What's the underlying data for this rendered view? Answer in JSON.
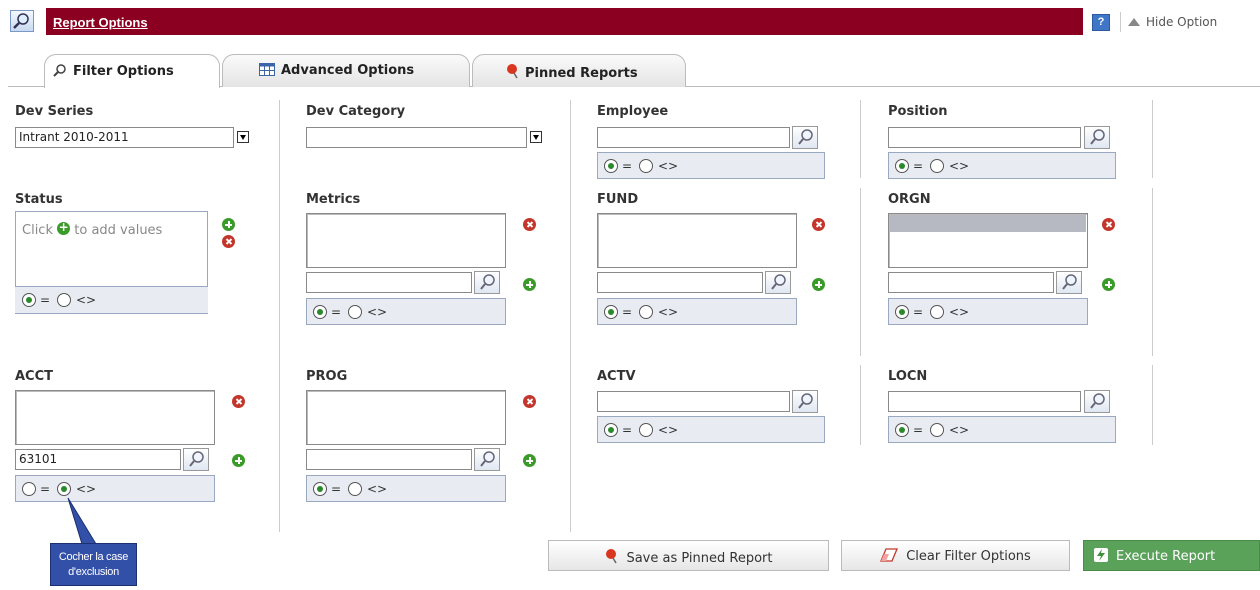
{
  "header": {
    "title": "Report Options",
    "help_label": "?",
    "hide_label": "Hide Option"
  },
  "tabs": [
    {
      "label": "Filter Options",
      "icon": "magnifier-icon",
      "active": true
    },
    {
      "label": "Advanced Options",
      "icon": "table-icon",
      "active": false
    },
    {
      "label": "Pinned Reports",
      "icon": "pin-icon",
      "active": false
    }
  ],
  "fields": {
    "dev_series": {
      "label": "Dev Series",
      "value": "Intrant 2010-2011"
    },
    "dev_category": {
      "label": "Dev Category",
      "value": ""
    },
    "employee": {
      "label": "Employee",
      "value": ""
    },
    "position": {
      "label": "Position",
      "value": ""
    },
    "status": {
      "label": "Status",
      "hint_pre": "Click",
      "hint_post": "to add values"
    },
    "metrics": {
      "label": "Metrics",
      "value": ""
    },
    "fund": {
      "label": "FUND",
      "value": ""
    },
    "orgn": {
      "label": "ORGN",
      "value": ""
    },
    "acct": {
      "label": "ACCT",
      "value": "63101"
    },
    "prog": {
      "label": "PROG",
      "value": ""
    },
    "actv": {
      "label": "ACTV",
      "value": ""
    },
    "locn": {
      "label": "LOCN",
      "value": ""
    }
  },
  "operator": {
    "equals": "=",
    "not_equals": "<>"
  },
  "callout": {
    "line1": "Cocher la case",
    "line2": "d'exclusion"
  },
  "buttons": {
    "save_pinned": "Save as Pinned Report",
    "clear_filter": "Clear Filter Options",
    "execute": "Execute Report"
  },
  "colors": {
    "header": "#8b0020",
    "execute": "#5aa25a",
    "add": "#3b9b2a",
    "remove": "#c2362b"
  }
}
